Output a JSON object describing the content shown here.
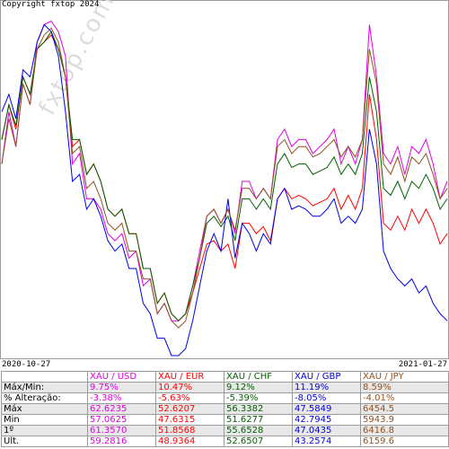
{
  "copyright": "Copyright fxtop 2024",
  "watermark": "fxtop.com",
  "x_start_label": "2020-10-27",
  "x_end_label": "2021-01-27",
  "chart_data": {
    "type": "line",
    "xlabel": "",
    "ylabel": "",
    "x_range": [
      "2020-10-27",
      "2021-01-27"
    ],
    "normalization": "each series scaled between its own Min and Max over the period",
    "series": [
      {
        "name": "XAU / USD",
        "color": "#e000e0",
        "values": [
          0.55,
          0.7,
          0.6,
          0.78,
          0.72,
          0.9,
          0.95,
          0.96,
          0.93,
          0.86,
          0.55,
          0.58,
          0.45,
          0.45,
          0.42,
          0.35,
          0.33,
          0.35,
          0.28,
          0.3,
          0.2,
          0.22,
          0.12,
          0.15,
          0.1,
          0.1,
          0.12,
          0.2,
          0.3,
          0.4,
          0.42,
          0.38,
          0.42,
          0.35,
          0.5,
          0.5,
          0.45,
          0.48,
          0.45,
          0.62,
          0.65,
          0.6,
          0.62,
          0.62,
          0.58,
          0.6,
          0.62,
          0.65,
          0.55,
          0.6,
          0.55,
          0.62,
          0.95,
          0.8,
          0.58,
          0.55,
          0.6,
          0.52,
          0.6,
          0.58,
          0.62,
          0.55,
          0.45,
          0.5
        ]
      },
      {
        "name": "XAU / EUR",
        "color": "#ff0000",
        "values": [
          0.62,
          0.72,
          0.65,
          0.8,
          0.75,
          0.88,
          0.9,
          0.92,
          0.88,
          0.8,
          0.6,
          0.62,
          0.52,
          0.55,
          0.5,
          0.42,
          0.4,
          0.42,
          0.35,
          0.35,
          0.25,
          0.25,
          0.15,
          0.18,
          0.12,
          0.1,
          0.12,
          0.18,
          0.25,
          0.32,
          0.33,
          0.3,
          0.32,
          0.25,
          0.38,
          0.38,
          0.35,
          0.37,
          0.33,
          0.45,
          0.48,
          0.45,
          0.46,
          0.45,
          0.43,
          0.44,
          0.45,
          0.48,
          0.42,
          0.46,
          0.42,
          0.48,
          0.75,
          0.62,
          0.38,
          0.36,
          0.4,
          0.36,
          0.42,
          0.38,
          0.42,
          0.38,
          0.32,
          0.35
        ]
      },
      {
        "name": "XAU / CHF",
        "color": "#006000",
        "values": [
          0.62,
          0.72,
          0.66,
          0.8,
          0.75,
          0.88,
          0.9,
          0.93,
          0.88,
          0.8,
          0.62,
          0.62,
          0.52,
          0.55,
          0.5,
          0.42,
          0.4,
          0.42,
          0.35,
          0.35,
          0.25,
          0.25,
          0.15,
          0.18,
          0.12,
          0.1,
          0.12,
          0.2,
          0.28,
          0.38,
          0.4,
          0.37,
          0.4,
          0.33,
          0.45,
          0.45,
          0.42,
          0.45,
          0.42,
          0.55,
          0.58,
          0.54,
          0.55,
          0.55,
          0.52,
          0.53,
          0.54,
          0.57,
          0.52,
          0.55,
          0.52,
          0.58,
          0.8,
          0.7,
          0.48,
          0.46,
          0.5,
          0.45,
          0.5,
          0.48,
          0.52,
          0.48,
          0.42,
          0.45
        ]
      },
      {
        "name": "XAU / GBP",
        "color": "#0000e0",
        "values": [
          0.7,
          0.75,
          0.68,
          0.82,
          0.8,
          0.9,
          0.95,
          0.93,
          0.86,
          0.7,
          0.5,
          0.52,
          0.42,
          0.45,
          0.4,
          0.33,
          0.3,
          0.32,
          0.25,
          0.25,
          0.15,
          0.12,
          0.05,
          0.05,
          0.0,
          0.0,
          0.02,
          0.1,
          0.2,
          0.3,
          0.35,
          0.3,
          0.45,
          0.28,
          0.38,
          0.35,
          0.3,
          0.35,
          0.32,
          0.45,
          0.48,
          0.42,
          0.43,
          0.42,
          0.4,
          0.4,
          0.42,
          0.45,
          0.38,
          0.4,
          0.38,
          0.42,
          0.65,
          0.55,
          0.3,
          0.25,
          0.22,
          0.2,
          0.22,
          0.18,
          0.2,
          0.15,
          0.12,
          0.1
        ]
      },
      {
        "name": "XAU / JPY",
        "color": "#905020",
        "values": [
          0.55,
          0.68,
          0.6,
          0.78,
          0.72,
          0.88,
          0.92,
          0.94,
          0.9,
          0.8,
          0.58,
          0.6,
          0.48,
          0.5,
          0.45,
          0.38,
          0.36,
          0.38,
          0.3,
          0.3,
          0.22,
          0.22,
          0.12,
          0.15,
          0.1,
          0.08,
          0.1,
          0.18,
          0.28,
          0.4,
          0.42,
          0.38,
          0.42,
          0.36,
          0.48,
          0.48,
          0.45,
          0.48,
          0.45,
          0.6,
          0.62,
          0.58,
          0.6,
          0.6,
          0.57,
          0.58,
          0.6,
          0.62,
          0.57,
          0.6,
          0.57,
          0.62,
          0.88,
          0.78,
          0.55,
          0.52,
          0.57,
          0.5,
          0.57,
          0.55,
          0.58,
          0.52,
          0.45,
          0.48
        ]
      }
    ],
    "table": {
      "headers": [
        "",
        "XAU / USD",
        "XAU / EUR",
        "XAU / CHF",
        "XAU / GBP",
        "XAU / JPY"
      ],
      "header_colors": [
        "#000000",
        "#e000e0",
        "#ff0000",
        "#006000",
        "#0000e0",
        "#905020"
      ],
      "rows": [
        {
          "label": "Máx/Min:",
          "values": [
            "9.75%",
            "10.47%",
            "9.12%",
            "11.19%",
            "8.59%"
          ]
        },
        {
          "label": "% Alteração:",
          "values": [
            "-3.38%",
            "-5.63%",
            "-5.39%",
            "-8.05%",
            "-4.01%"
          ]
        },
        {
          "label": "Máx",
          "values": [
            "62.6235",
            "52.6207",
            "56.3382",
            "47.5849",
            "6454.5"
          ]
        },
        {
          "label": "Min",
          "values": [
            "57.0625",
            "47.6315",
            "51.6277",
            "42.7945",
            "5943.9"
          ]
        },
        {
          "label": "1º",
          "values": [
            "61.3570",
            "51.8568",
            "55.6528",
            "47.0435",
            "6416.8"
          ]
        },
        {
          "label": "Ult.",
          "values": [
            "59.2816",
            "48.9364",
            "52.6507",
            "43.2574",
            "6159.6"
          ]
        }
      ]
    }
  }
}
